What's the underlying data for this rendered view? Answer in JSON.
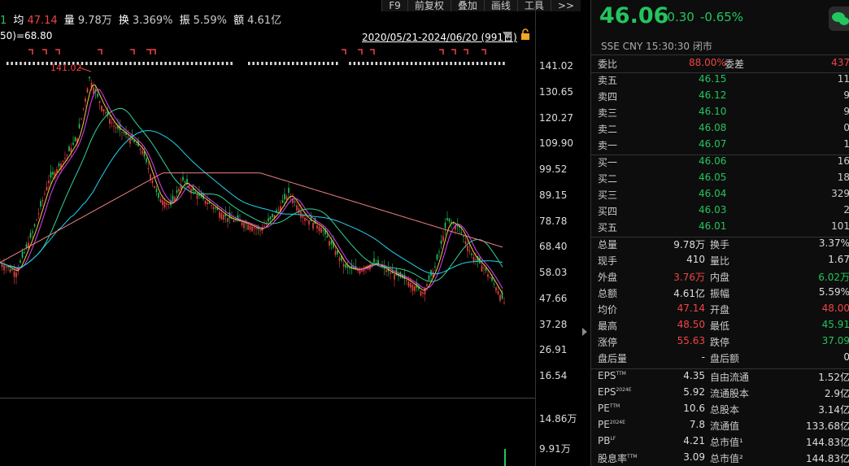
{
  "topbar": {
    "prefix": "1",
    "avg_label": "均",
    "avg_value": "47.14",
    "vol_label": "量",
    "vol_value": "9.78万",
    "turnover_label": "换",
    "turnover_value": "3.369%",
    "amp_label": "振",
    "amp_value": "5.59%",
    "amount_label": "额",
    "amount_value": "4.61亿",
    "buttons": [
      "F9",
      "前复权",
      "叠加",
      "画线",
      "工具",
      ">>"
    ]
  },
  "ma_label": "50)=68.80",
  "range_label": "2020/05/21-2024/06/20 (991日)",
  "high_marker": "141.02",
  "price_axis": [
    "141.02",
    "130.65",
    "120.27",
    "109.90",
    "99.52",
    "89.15",
    "78.78",
    "68.40",
    "58.03",
    "47.66",
    "37.28",
    "26.91",
    "16.54"
  ],
  "volume_axis": [
    "14.86万",
    "9.91万"
  ],
  "quote": {
    "price": "46.06",
    "change": "-0.30",
    "change_pct": "-0.65%",
    "meta": "SSE  CNY  15:30:30  闭市",
    "weibi_label": "委比",
    "weibi_value": "88.00%",
    "weicha_label": "委差",
    "weicha_value": "437",
    "asks": [
      {
        "label": "卖五",
        "price": "46.15",
        "qty": "11"
      },
      {
        "label": "卖四",
        "price": "46.12",
        "qty": "9"
      },
      {
        "label": "卖三",
        "price": "46.10",
        "qty": "9"
      },
      {
        "label": "卖二",
        "price": "46.08",
        "qty": "0"
      },
      {
        "label": "卖一",
        "price": "46.07",
        "qty": "1"
      }
    ],
    "bids": [
      {
        "label": "买一",
        "price": "46.06",
        "qty": "16"
      },
      {
        "label": "买二",
        "price": "46.05",
        "qty": "18"
      },
      {
        "label": "买三",
        "price": "46.04",
        "qty": "329"
      },
      {
        "label": "买四",
        "price": "46.03",
        "qty": "2"
      },
      {
        "label": "买五",
        "price": "46.01",
        "qty": "101"
      }
    ],
    "stats": [
      {
        "l1": "总量",
        "v1": "9.78万",
        "l2": "换手",
        "v2": "3.37%",
        "c1": "#ddd",
        "c2": "#ddd"
      },
      {
        "l1": "现手",
        "v1": "410",
        "l2": "量比",
        "v2": "1.67",
        "c1": "#ddd",
        "c2": "#ddd"
      },
      {
        "l1": "外盘",
        "v1": "3.76万",
        "l2": "内盘",
        "v2": "6.02万",
        "c1": "#ef4444",
        "c2": "#22c55e"
      },
      {
        "l1": "总额",
        "v1": "4.61亿",
        "l2": "振幅",
        "v2": "5.59%",
        "c1": "#ddd",
        "c2": "#ddd"
      },
      {
        "l1": "均价",
        "v1": "47.14",
        "l2": "开盘",
        "v2": "48.00",
        "c1": "#ef4444",
        "c2": "#ef4444"
      },
      {
        "l1": "最高",
        "v1": "48.50",
        "l2": "最低",
        "v2": "45.91",
        "c1": "#ef4444",
        "c2": "#22c55e"
      },
      {
        "l1": "涨停",
        "v1": "55.63",
        "l2": "跌停",
        "v2": "37.09",
        "c1": "#ef4444",
        "c2": "#22c55e"
      },
      {
        "l1": "盘后量",
        "v1": "-",
        "l2": "盘后额",
        "v2": "0",
        "c1": "#ddd",
        "c2": "#ddd"
      }
    ],
    "fundamentals": [
      {
        "l1": "EPS",
        "s1": "TTM",
        "v1": "4.35",
        "l2": "自由流通",
        "v2": "1.52亿"
      },
      {
        "l1": "EPS",
        "s1": "2024E",
        "v1": "5.92",
        "l2": "流通股本",
        "v2": "2.9亿"
      },
      {
        "l1": "PE",
        "s1": "TTM",
        "v1": "10.6",
        "l2": "总股本",
        "v2": "3.14亿"
      },
      {
        "l1": "PE",
        "s1": "2024E",
        "v1": "7.8",
        "l2": "流通值",
        "v2": "133.68亿"
      },
      {
        "l1": "PB",
        "s1": "LF",
        "v1": "4.21",
        "l2": "总市值¹",
        "v2": "144.83亿"
      },
      {
        "l1": "股息率",
        "s1": "TTM",
        "v1": "3.09",
        "l2": "总市值²",
        "v2": "144.83亿"
      }
    ]
  },
  "colors": {
    "up": "#ef4444",
    "down": "#22c55e",
    "ma_yellow": "#f5c542",
    "ma_magenta": "#e040fb",
    "ma_green": "#34d399",
    "ma_cyan": "#22d3ee",
    "ma_pink": "#f08080"
  }
}
